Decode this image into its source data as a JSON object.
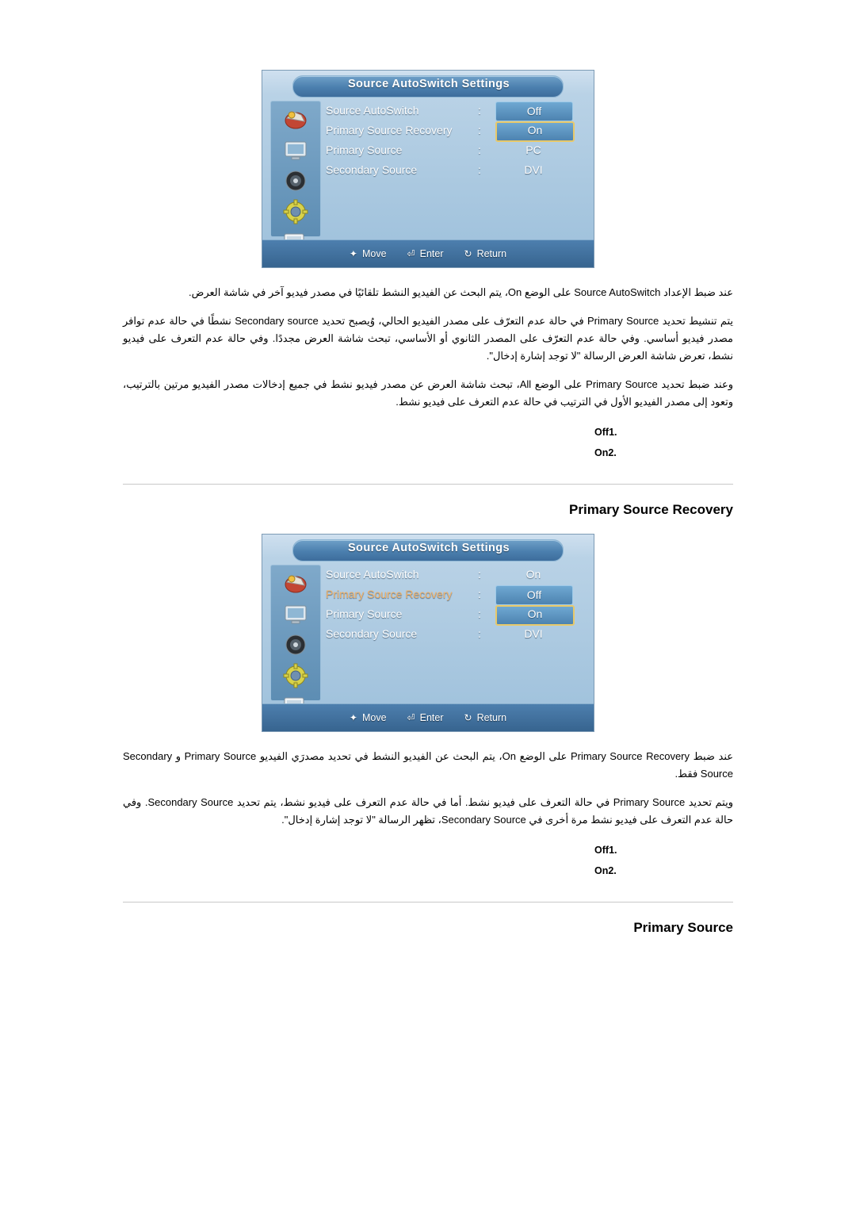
{
  "osd1": {
    "title": "Source AutoSwitch Settings",
    "rows": [
      {
        "label": "Source AutoSwitch",
        "colon": ":",
        "value": "Off",
        "style": "box",
        "highlight": false
      },
      {
        "label": "Primary Source Recovery",
        "colon": ":",
        "value": "On",
        "style": "sel",
        "highlight": false
      },
      {
        "label": "Primary Source",
        "colon": ":",
        "value": "PC",
        "style": "plain",
        "highlight": false
      },
      {
        "label": "Secondary Source",
        "colon": ":",
        "value": "DVI",
        "style": "plain",
        "highlight": false
      }
    ],
    "footer": [
      {
        "icon": "move-icon",
        "label": "Move"
      },
      {
        "icon": "enter-icon",
        "label": "Enter"
      },
      {
        "icon": "return-icon",
        "label": "Return"
      }
    ],
    "icons": [
      "picture-icon",
      "monitor-icon",
      "sound-icon",
      "setup-icon",
      "multi-control-icon"
    ]
  },
  "osd2": {
    "title": "Source AutoSwitch Settings",
    "rows": [
      {
        "label": "Source AutoSwitch",
        "colon": ":",
        "value": "On",
        "style": "plain",
        "highlight": false
      },
      {
        "label": "Primary Source Recovery",
        "colon": ":",
        "value": "Off",
        "style": "box",
        "highlight": true
      },
      {
        "label": "Primary Source",
        "colon": ":",
        "value": "On",
        "style": "sel",
        "highlight": false
      },
      {
        "label": "Secondary Source",
        "colon": ":",
        "value": "DVI",
        "style": "plain",
        "highlight": false
      }
    ],
    "footer": [
      {
        "icon": "move-icon",
        "label": "Move"
      },
      {
        "icon": "enter-icon",
        "label": "Enter"
      },
      {
        "icon": "return-icon",
        "label": "Return"
      }
    ],
    "icons": [
      "picture-icon",
      "monitor-icon",
      "sound-icon",
      "setup-icon",
      "multi-control-icon"
    ]
  },
  "section1": {
    "paragraphs": [
      "عند ضبط الإعداد Source AutoSwitch على الوضع On، يتم البحث عن الفيديو النشط تلقائيًا في مصدر فيديو آخر في شاشة العرض.",
      "يتم تنشيط تحديد Primary Source في حالة عدم التعرّف على مصدر الفيديو الحالي، وُيصبح تحديد Secondary source نشطًا في حالة عدم توافر مصدر فيديو أساسي. وفي حالة عدم التعرّف على المصدر الثانوي أو الأساسي، تبحث شاشة العرض مجددًا. وفي حالة عدم التعرف على فيديو نشط، تعرض شاشة العرض الرسالة \"لا توجد إشارة إدخال\".",
      "وعند ضبط تحديد Primary Source على الوضع All، تبحث شاشة العرض عن مصدر فيديو نشط في جميع إدخالات مصدر الفيديو مرتين بالترتيب، وتعود إلى مصدر الفيديو الأول في الترتيب في حالة عدم التعرف على فيديو نشط."
    ],
    "options": [
      {
        "num": "1.",
        "label": "Off"
      },
      {
        "num": "2.",
        "label": "On"
      }
    ]
  },
  "heading1": "Primary Source Recovery",
  "section2": {
    "paragraphs": [
      "عند ضبط Primary Source Recovery على الوضع On، يتم البحث عن الفيديو النشط في تحديد مصدرَي الفيديو Primary Source و Secondary Source فقط.",
      "ويتم تحديد Primary Source في حالة التعرف على فيديو نشط. أما في حالة عدم التعرف على فيديو نشط، يتم تحديد Secondary Source. وفي حالة عدم التعرف على فيديو نشط مرة أخرى في Secondary Source، تظهر الرسالة \"لا توجد إشارة إدخال\"."
    ],
    "options": [
      {
        "num": "1.",
        "label": "Off"
      },
      {
        "num": "2.",
        "label": "On"
      }
    ]
  },
  "heading2": "Primary Source"
}
